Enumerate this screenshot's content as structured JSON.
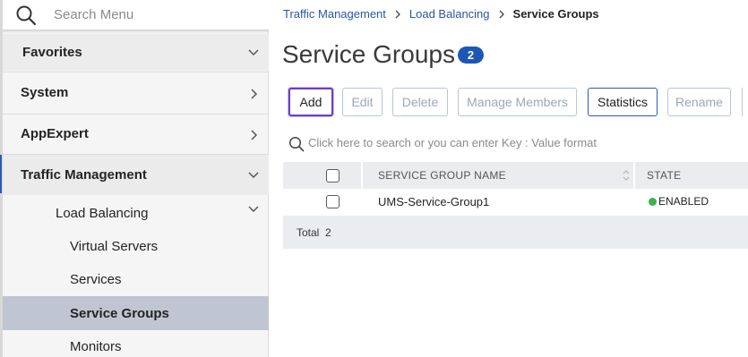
{
  "sidebar": {
    "search_placeholder": "Search Menu",
    "items": [
      {
        "label": "Favorites",
        "chevron": "chevron-down"
      },
      {
        "label": "System",
        "chevron": "chevron-right"
      },
      {
        "label": "AppExpert",
        "chevron": "chevron-right"
      },
      {
        "label": "Traffic Management",
        "chevron": "chevron-down"
      },
      {
        "label": "Load Balancing",
        "chevron": "chevron-down"
      },
      {
        "label": "Virtual Servers"
      },
      {
        "label": "Services"
      },
      {
        "label": "Service Groups"
      },
      {
        "label": "Monitors"
      }
    ]
  },
  "breadcrumb": {
    "items": [
      "Traffic Management",
      "Load Balancing",
      "Service Groups"
    ]
  },
  "page": {
    "title": "Service Groups",
    "count": "2"
  },
  "toolbar": {
    "buttons": [
      "Add",
      "Edit",
      "Delete",
      "Manage Members",
      "Statistics",
      "Rename"
    ]
  },
  "filter": {
    "placeholder": "Click here to search or you can enter Key : Value format"
  },
  "table": {
    "columns": [
      "SERVICE GROUP NAME",
      "STATE"
    ],
    "rows": [
      {
        "name": "UMS-Service-Group1",
        "state": "ENABLED",
        "state_color": "#3fb24a"
      }
    ],
    "total_label": "Total",
    "total_value": "2"
  },
  "colors": {
    "accent": "#1d57b6",
    "active_nav": "#bfc6d2",
    "focus_ring": "#6a3fc7"
  }
}
